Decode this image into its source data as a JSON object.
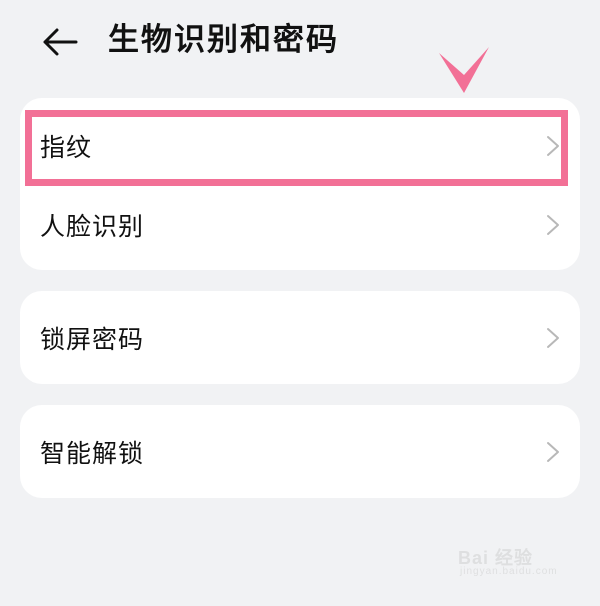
{
  "header": {
    "back_icon": "arrow-left-icon",
    "title": "生物识别和密码"
  },
  "groups": [
    {
      "items": [
        {
          "label": "指纹",
          "icon": "chevron-right-icon"
        },
        {
          "label": "人脸识别",
          "icon": "chevron-right-icon"
        }
      ]
    },
    {
      "items": [
        {
          "label": "锁屏密码",
          "icon": "chevron-right-icon"
        }
      ]
    },
    {
      "items": [
        {
          "label": "智能解锁",
          "icon": "chevron-right-icon"
        }
      ]
    }
  ],
  "annotation": {
    "highlight_color": "#f27096",
    "highlight_target": "指纹",
    "pointer_icon": "down-arrow-marker-icon"
  },
  "watermark": {
    "logo": "Bai 经验",
    "sub": "jingyan.baidu.com"
  },
  "colors": {
    "background": "#f1f2f4",
    "card": "#ffffff",
    "text": "#111111",
    "chevron": "#b8b8b8",
    "accent": "#f27096"
  }
}
